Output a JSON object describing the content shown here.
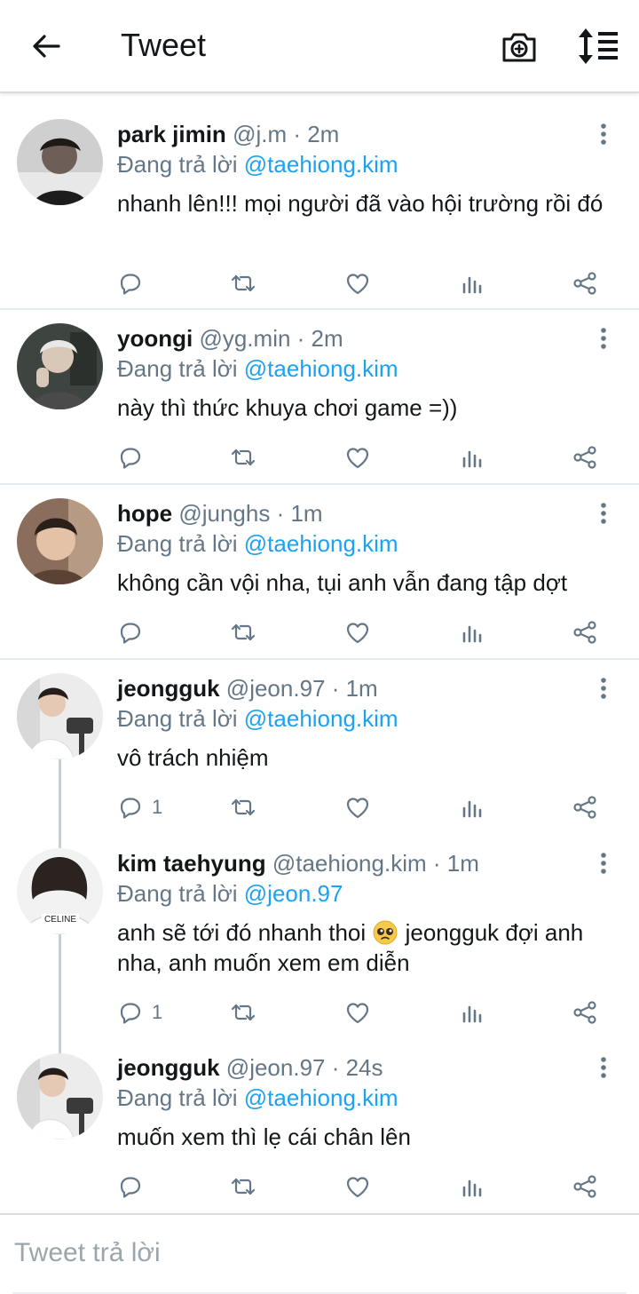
{
  "header": {
    "title": "Tweet",
    "back_icon": "arrow-left-icon",
    "camera_icon": "camera-plus-icon",
    "sort_icon": "sort-icon"
  },
  "colors": {
    "link": "#1da1f2",
    "muted": "#657786",
    "text": "#14171a"
  },
  "tweets": [
    {
      "name": "park jimin",
      "handle": "@j.m · 2m",
      "reply_prefix": "Đang trả lời ",
      "reply_to": "@taehiong.kim",
      "text": "nhanh lên!!! mọi người đã vào hội trường rồi đó",
      "reply_count": ""
    },
    {
      "name": "yoongi",
      "handle": "@yg.min · 2m",
      "reply_prefix": "Đang trả lời ",
      "reply_to": "@taehiong.kim",
      "text": "này thì thức khuya chơi game =))",
      "reply_count": ""
    },
    {
      "name": "hope",
      "handle": "@junghs · 1m",
      "reply_prefix": "Đang trả lời ",
      "reply_to": "@taehiong.kim",
      "text": "không cần vội nha, tụi anh vẫn đang tập dợt",
      "reply_count": ""
    },
    {
      "name": "jeongguk",
      "handle": "@jeon.97 · 1m",
      "reply_prefix": "Đang trả lời ",
      "reply_to": "@taehiong.kim",
      "text": "vô trách nhiệm",
      "reply_count": "1"
    },
    {
      "name": "kim taehyung",
      "handle": "@taehiong.kim · 1m",
      "reply_prefix": "Đang trả lời ",
      "reply_to": "@jeon.97",
      "text_before_emoji": "anh sẽ tới đó nhanh thoi",
      "text_after_emoji": " jeongguk đợi anh nha, anh muốn xem em diễn",
      "emoji": "pleading-face-emoji",
      "reply_count": "1"
    },
    {
      "name": "jeongguk",
      "handle": "@jeon.97 · 24s",
      "reply_prefix": "Đang trả lời ",
      "reply_to": "@taehiong.kim",
      "text": "muốn xem thì lẹ cái chân lên",
      "reply_count": ""
    }
  ],
  "composer": {
    "placeholder": "Tweet trả lời"
  }
}
